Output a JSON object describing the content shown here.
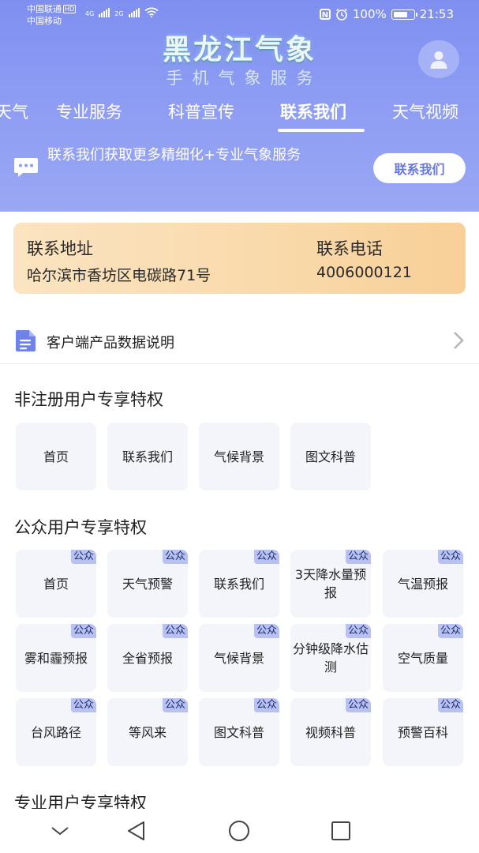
{
  "status_bar": {
    "carrier1": "中国联通",
    "carrier1_badge": "HD",
    "carrier2": "中国移动",
    "net1": "4G",
    "net2": "2G",
    "battery": "100%",
    "time": "21:53"
  },
  "header": {
    "app_title": "黑龙江气象",
    "app_subtitle": "手机气象服务"
  },
  "tabs": [
    {
      "label": "天气",
      "active": false
    },
    {
      "label": "专业服务",
      "active": false
    },
    {
      "label": "科普宣传",
      "active": false
    },
    {
      "label": "联系我们",
      "active": true
    },
    {
      "label": "天气视频",
      "active": false
    }
  ],
  "banner": {
    "text": "联系我们获取更多精细化+专业气象服务",
    "button_label": "联系我们"
  },
  "contact": {
    "address_label": "联系地址",
    "address_value": "哈尔滨市香坊区电碳路71号",
    "phone_label": "联系电话",
    "phone_value": "4006000121"
  },
  "product_row": {
    "label": "客户端产品数据说明"
  },
  "sections": {
    "non_registered": {
      "title": "非注册用户专享特权",
      "items": [
        "首页",
        "联系我们",
        "气候背景",
        "图文科普"
      ]
    },
    "public": {
      "title": "公众用户专享特权",
      "badge": "公众",
      "items": [
        "首页",
        "天气预警",
        "联系我们",
        "3天降水量预报",
        "气温预报",
        "雾和霾预报",
        "全省预报",
        "气候背景",
        "分钟级降水估测",
        "空气质量",
        "台风路径",
        "等风来",
        "图文科普",
        "视频科普",
        "预警百科"
      ]
    },
    "professional": {
      "title": "专业用户专享特权"
    }
  },
  "colors": {
    "header_top": "#7f8ff0",
    "header_bottom": "#9aa7f4",
    "accent": "#6677e6",
    "card_start": "#fbe4c1",
    "card_end": "#f8cf97",
    "badge": "#b7c2f3",
    "tile": "#f3f5fb"
  },
  "icons": {
    "avatar": "user-avatar-icon",
    "banner": "chat-bubble-icon",
    "product": "document-icon",
    "product_arrow": "chevron-right-icon",
    "nav": [
      "collapse-down-icon",
      "back-triangle-icon",
      "home-circle-icon",
      "recents-square-icon"
    ]
  }
}
